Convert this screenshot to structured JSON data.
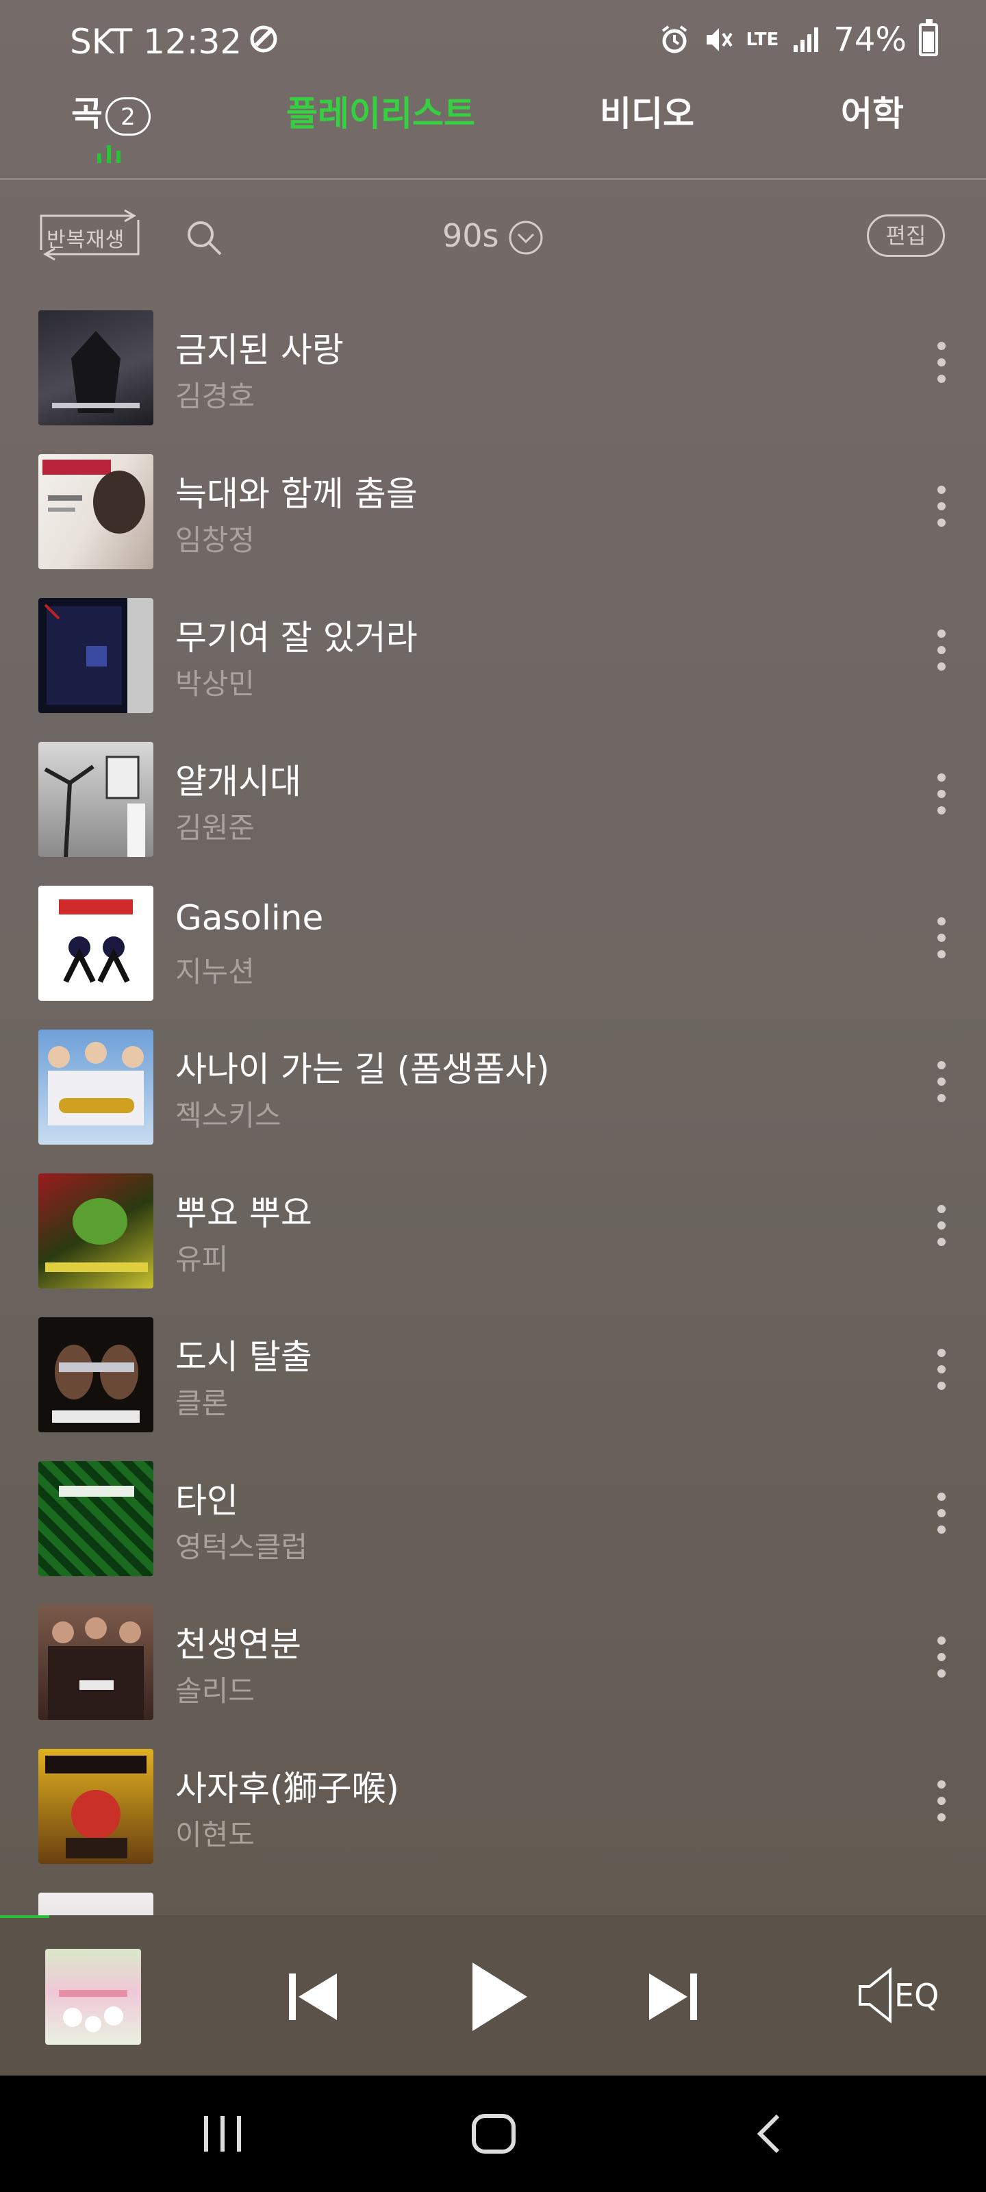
{
  "status_bar": {
    "time": "SKT 12:32",
    "network": "LTE",
    "battery": "74%",
    "battery_level": 0.74
  },
  "tabs": [
    {
      "label": "곡",
      "count": "2"
    },
    {
      "label": "플레이리스트"
    },
    {
      "label": "비디오"
    },
    {
      "label": "어학"
    }
  ],
  "toolbar": {
    "repeat_label": "반복재생",
    "playlist_name": "90s",
    "edit_label": "편집"
  },
  "songs": [
    {
      "title": "금지된 사랑",
      "artist": "김경호"
    },
    {
      "title": "늑대와 함께 춤을",
      "artist": "임창정"
    },
    {
      "title": "무기여 잘 있거라",
      "artist": "박상민"
    },
    {
      "title": "얄개시대",
      "artist": "김원준"
    },
    {
      "title": "Gasoline",
      "artist": "지누션"
    },
    {
      "title": "사나이 가는 길 (폼생폼사)",
      "artist": "젝스키스"
    },
    {
      "title": "뿌요 뿌요",
      "artist": "유피"
    },
    {
      "title": "도시 탈출",
      "artist": "클론"
    },
    {
      "title": "타인",
      "artist": "영턱스클럽"
    },
    {
      "title": "천생연분",
      "artist": "솔리드"
    },
    {
      "title": "사자후(獅子喉)",
      "artist": "이현도"
    }
  ],
  "player": {
    "progress": 0.05,
    "eq_label": "EQ"
  },
  "colors": {
    "accent": "#35d040",
    "background": "#6c6560",
    "player_bg": "#5b5249"
  }
}
